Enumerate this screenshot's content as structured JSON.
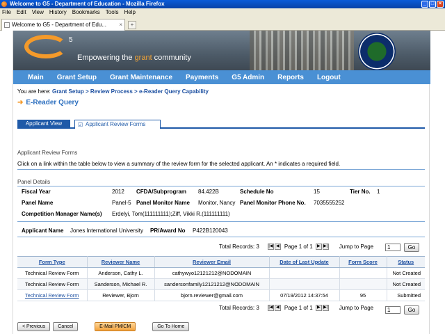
{
  "window": {
    "title": "Welcome to G5 - Department of Education - Mozilla Firefox",
    "controls": [
      "_",
      "□",
      "×"
    ]
  },
  "menu": [
    "File",
    "Edit",
    "View",
    "History",
    "Bookmarks",
    "Tools",
    "Help"
  ],
  "browser_tab": {
    "label": "Welcome to G5 - Department of Edu...",
    "close": "×",
    "new_tab": "+"
  },
  "banner": {
    "logo": "G",
    "logo_sup": "5",
    "tagline_pre": "Empowering the ",
    "tagline_hl": "grant",
    "tagline_post": " community"
  },
  "nav": [
    "Main",
    "Grant Setup",
    "Grant Maintenance",
    "Payments",
    "G5 Admin",
    "Reports",
    "Logout"
  ],
  "breadcrumb": {
    "prefix": "You are here: ",
    "items": [
      "Grant Setup",
      " > ",
      "Review Process",
      " > ",
      "e-Reader Query Capability"
    ]
  },
  "page_title": "E-Reader Query",
  "tabs": {
    "tab1": "Applicant View",
    "tab2": "Applicant Review Forms"
  },
  "section": {
    "title": "Applicant Review Forms",
    "instructions": "Click on a link within the table below to view a summary of the review form for the selected applicant. An * indicates a required field."
  },
  "panel": {
    "heading": "Panel Details",
    "fiscal_year_label": "Fiscal Year",
    "fiscal_year": "2012",
    "cfda_label": "CFDA/Subprogram",
    "cfda": "84.422B",
    "schedule_label": "Schedule No",
    "schedule": "15",
    "tier_label": "Tier No.",
    "tier": "1",
    "panel_name_label": "Panel Name",
    "panel_name": "Panel-5",
    "monitor_label": "Panel Monitor Name",
    "monitor": "Monitor, Nancy",
    "phone_label": "Panel Monitor Phone No.",
    "phone": "7035555252",
    "cm_label": "Competition Manager Name(s)",
    "cm": "Erdelyi, Tom(111111111);Ziff, Vikki R.(111111111)"
  },
  "applicant": {
    "name_label": "Applicant Name",
    "name": "Jones International University",
    "pr_label": "PR/Award No",
    "pr": "P422B120043"
  },
  "pager": {
    "total_label": "Total Records:",
    "total": "3",
    "page_text": "Page 1 of 1",
    "jump_label": "Jump to Page",
    "jump_value": "1",
    "go": "Go",
    "first": "|◀",
    "prev": "◀",
    "next": "▶",
    "last": "▶|"
  },
  "table": {
    "headers": [
      "Form Type",
      "Reviewer Name",
      "Reviewer Email",
      "Date of Last Update",
      "Form Score",
      "Status"
    ],
    "rows": [
      [
        "Technical Review Form",
        "Anderson, Cathy L.",
        "cathywyo12121212@NODOMAIN",
        "",
        "",
        "Not Created"
      ],
      [
        "Technical Review Form",
        "Sanderson, Michael R.",
        "sandersonfamily12121212@NODOMAIN",
        "",
        "",
        "Not Created"
      ],
      [
        "Technical Review Form",
        "Reviewer, Bjorn",
        "bjorn.reviewer@gmail.com",
        "07/19/2012 14:37:54",
        "95",
        "Submitted"
      ]
    ]
  },
  "buttons": [
    "< Previous",
    "Cancel",
    "E-Mail PM/CM",
    "Go To Home"
  ]
}
